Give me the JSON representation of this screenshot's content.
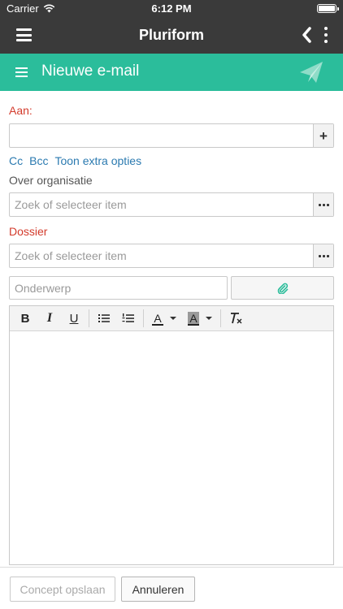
{
  "status_bar": {
    "carrier": "Carrier",
    "time": "6:12 PM"
  },
  "app_bar": {
    "title": "Pluriform"
  },
  "section": {
    "title": "Nieuwe e-mail"
  },
  "form": {
    "to_label": "Aan:",
    "to_value": "",
    "cc_label": "Cc",
    "bcc_label": "Bcc",
    "extra_options_label": "Toon extra opties",
    "organization_label": "Over organisatie",
    "organization_placeholder": "Zoek of selecteer item",
    "dossier_label": "Dossier",
    "dossier_placeholder": "Zoek of selecteer item",
    "subject_placeholder": "Onderwerp"
  },
  "toolbar": {
    "bold": "B",
    "italic": "I",
    "underline": "U",
    "font_color": "A",
    "background_color": "A",
    "clear_format": "T"
  },
  "footer": {
    "save_draft": "Concept opslaan",
    "cancel": "Annuleren"
  },
  "colors": {
    "top_bar": "#3a3a3a",
    "accent": "#2bbd9b",
    "required_label": "#d33b2c",
    "link": "#2b7ab0"
  },
  "icons": [
    "wifi-icon",
    "battery-icon",
    "hamburger-icon",
    "back-icon",
    "kebab-icon",
    "menu-icon",
    "send-icon",
    "plus-icon",
    "dots-icon",
    "paperclip-icon",
    "bullet-list-icon",
    "numbered-list-icon",
    "clear-format-icon"
  ]
}
